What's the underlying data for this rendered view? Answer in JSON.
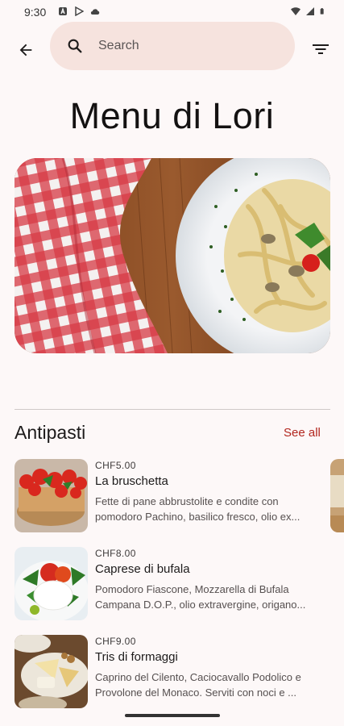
{
  "status_bar": {
    "time": "9:30",
    "left_icons": [
      "notification-a-icon",
      "play-store-icon",
      "cloud-icon"
    ],
    "right_icons": [
      "wifi-icon",
      "signal-icon",
      "battery-icon"
    ]
  },
  "top_bar": {
    "back_icon": "arrow-left-icon",
    "search_icon": "search-icon",
    "search_placeholder": "Search",
    "filter_icon": "filter-icon"
  },
  "page": {
    "title": "Menu di Lori"
  },
  "section": {
    "title": "Antipasti",
    "see_all": "See all"
  },
  "menu_items": [
    {
      "price": "CHF5.00",
      "name": "La bruschetta",
      "description": "Fette di pane abbrustolite e condite con pomodoro Pachino, basilico fresco, olio ex..."
    },
    {
      "price": "CHF8.00",
      "name": "Caprese di bufala",
      "description": "Pomodoro Fiascone, Mozzarella di Bufala Campana D.O.P., olio extravergine, origano..."
    },
    {
      "price": "CHF9.00",
      "name": "Tris di formaggi",
      "description": "Caprino del Cilento, Caciocavallo Podolico e Provolone del Monaco. Serviti con noci e ..."
    }
  ],
  "colors": {
    "background": "#fdf8f8",
    "search_bg": "#f6e3de",
    "accent": "#b2261e"
  }
}
